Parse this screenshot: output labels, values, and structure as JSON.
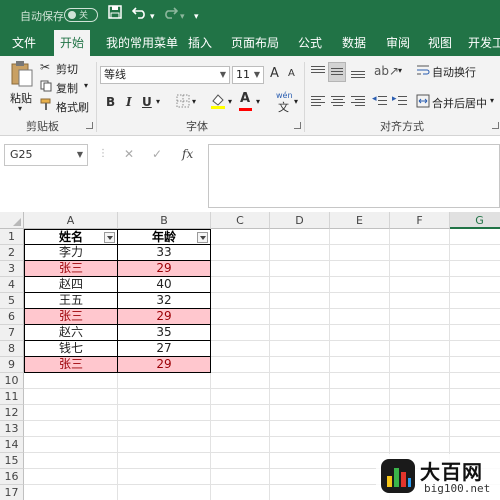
{
  "titlebar": {
    "autosave_label": "自动保存",
    "autosave_state": "关",
    "save_icon": "save-icon",
    "undo_icon": "undo-icon",
    "redo_icon": "redo-icon"
  },
  "tabs": [
    {
      "label": "文件"
    },
    {
      "label": "开始"
    },
    {
      "label": "我的常用菜单"
    },
    {
      "label": "插入"
    },
    {
      "label": "页面布局"
    },
    {
      "label": "公式"
    },
    {
      "label": "数据"
    },
    {
      "label": "审阅"
    },
    {
      "label": "视图"
    },
    {
      "label": "开发工"
    }
  ],
  "ribbon": {
    "clipboard": {
      "paste": "粘贴",
      "cut": "剪切",
      "copy": "复制",
      "format_painter": "格式刷",
      "group_label": "剪贴板"
    },
    "font": {
      "font_name": "等线",
      "font_size": "11",
      "grow": "A",
      "shrink": "A",
      "bold": "B",
      "italic": "I",
      "underline": "U",
      "font_color_letter": "A",
      "wen": "wén",
      "wen_char": "文",
      "group_label": "字体"
    },
    "alignment": {
      "wrap_text": "自动换行",
      "merge_center": "合并后居中",
      "group_label": "对齐方式"
    }
  },
  "formula_bar": {
    "name_box": "G25",
    "cancel": "✕",
    "enter": "✓",
    "fx": "fx",
    "value": ""
  },
  "sheet": {
    "columns": [
      "A",
      "B",
      "C",
      "D",
      "E",
      "F",
      "G"
    ],
    "rows": [
      "1",
      "2",
      "3",
      "4",
      "5",
      "6",
      "7",
      "8",
      "9",
      "10",
      "11",
      "12",
      "13",
      "14",
      "15",
      "16",
      "17"
    ],
    "header": {
      "name": "姓名",
      "age": "年龄"
    },
    "data": [
      {
        "name": "李力",
        "age": "33",
        "highlight": false
      },
      {
        "name": "张三",
        "age": "29",
        "highlight": true
      },
      {
        "name": "赵四",
        "age": "40",
        "highlight": false
      },
      {
        "name": "王五",
        "age": "32",
        "highlight": false
      },
      {
        "name": "张三",
        "age": "29",
        "highlight": true
      },
      {
        "name": "赵六",
        "age": "35",
        "highlight": false
      },
      {
        "name": "钱七",
        "age": "27",
        "highlight": false
      },
      {
        "name": "张三",
        "age": "29",
        "highlight": true
      }
    ],
    "highlight_fill": "#ffc7ce",
    "highlight_text": "#9c0006"
  },
  "watermark": {
    "title": "大百网",
    "url": "big100.net"
  },
  "colors": {
    "accent": "#217346"
  }
}
